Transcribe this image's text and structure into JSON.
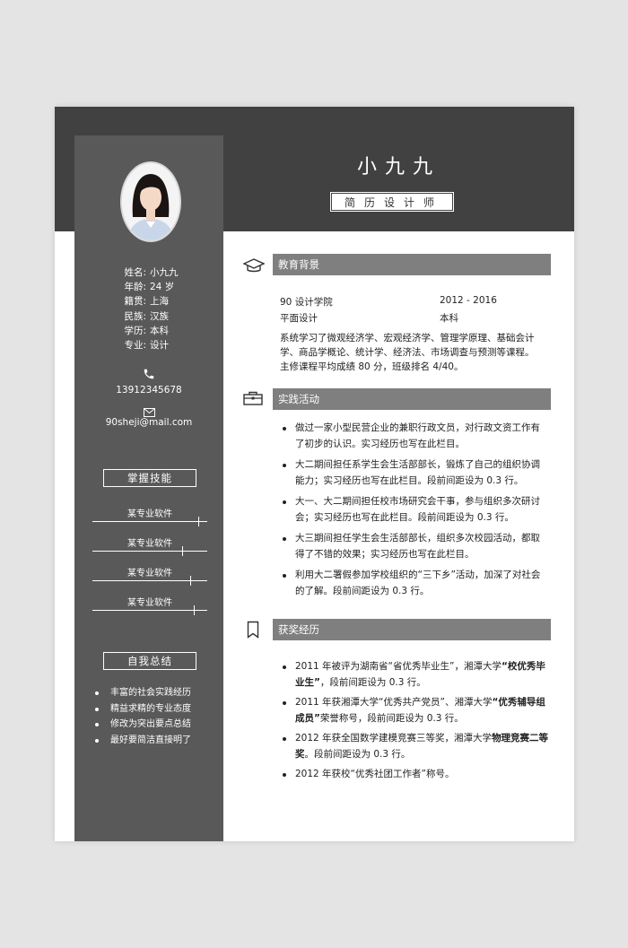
{
  "header": {
    "name": "小九九",
    "job_title": "简历设计师"
  },
  "profile": {
    "info": [
      {
        "label": "姓名:",
        "value": "小九九"
      },
      {
        "label": "年龄:",
        "value": "24 岁"
      },
      {
        "label": "籍贯:",
        "value": "上海"
      },
      {
        "label": "民族:",
        "value": "汉族"
      },
      {
        "label": "学历:",
        "value": "本科"
      },
      {
        "label": "专业:",
        "value": "设计"
      }
    ],
    "phone": "13912345678",
    "email": "90sheji@mail.com",
    "phone_icon": "phone-icon",
    "email_icon": "envelope-icon"
  },
  "skills": {
    "heading": "掌握技能",
    "items": [
      {
        "label": "某专业软件",
        "level": 0.92
      },
      {
        "label": "某专业软件",
        "level": 0.78
      },
      {
        "label": "某专业软件",
        "level": 0.85
      },
      {
        "label": "某专业软件",
        "level": 0.88
      }
    ]
  },
  "summary": {
    "heading": "自我总结",
    "items": [
      "丰富的社会实践经历",
      "精益求精的专业态度",
      "修改为突出要点总结",
      "最好要简洁直接明了"
    ]
  },
  "education": {
    "heading": "教育背景",
    "icon": "graduation-cap-icon",
    "school": "90 设计学院",
    "years": "2012 - 2016",
    "major": "平面设计",
    "degree": "本科",
    "description": "系统学习了微观经济学、宏观经济学、管理学原理、基础会计学、商品学概论、统计学、经济法、市场调查与预测等课程。",
    "gpa": "主修课程平均成绩 80 分，班级排名 4/40。"
  },
  "practice": {
    "heading": "实践活动",
    "icon": "briefcase-icon",
    "items": [
      "做过一家小型民营企业的兼职行政文员，对行政文资工作有了初步的认识。实习经历也写在此栏目。",
      "大二期间担任系学生会生活部部长，锻炼了自己的组织协调能力；实习经历也写在此栏目。段前间距设为 0.3 行。",
      "大一、大二期间担任校市场研究会干事，参与组织多次研讨会；实习经历也写在此栏目。段前间距设为 0.3 行。",
      "大三期间担任学生会生活部部长，组织多次校园活动，都取得了不错的效果；实习经历也写在此栏目。",
      "利用大二署假参加学校组织的“三下乡”活动，加深了对社会的了解。段前间距设为 0.3 行。"
    ]
  },
  "awards": {
    "heading": "获奖经历",
    "icon": "bookmark-icon",
    "items": [
      {
        "pre": "2011 年被评为湖南省“省优秀毕业生”，湘潭大学",
        "bold": "“校优秀毕业生”",
        "post": "，段前间距设为 0.3 行。"
      },
      {
        "pre": "2011 年获湘潭大学“优秀共产党员”、湘潭大学",
        "bold": "“优秀辅导组成员”",
        "post": "荣誉称号，段前间距设为 0.3 行。"
      },
      {
        "pre": "2012 年获全国数学建模竞赛三等奖，湘潭大学",
        "bold": "物理竞赛二等奖",
        "post": "。段前间距设为 0.3 行。"
      },
      {
        "pre": "2012 年获校“优秀社团工作者”称号。",
        "bold": "",
        "post": ""
      }
    ]
  }
}
